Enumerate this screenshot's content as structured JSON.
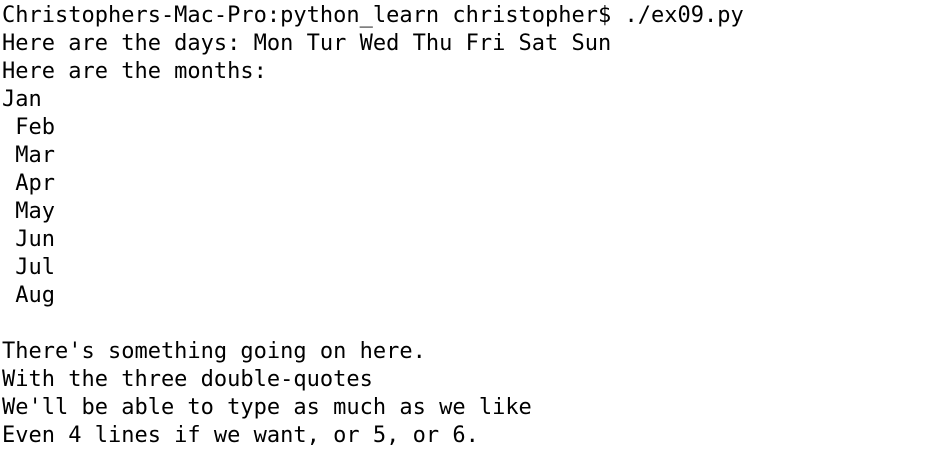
{
  "terminal": {
    "lines": [
      "Christophers-Mac-Pro:python_learn christopher$ ./ex09.py",
      "Here are the days: Mon Tur Wed Thu Fri Sat Sun",
      "Here are the months:",
      "Jan",
      " Feb",
      " Mar",
      " Apr",
      " May",
      " Jun",
      " Jul",
      " Aug",
      "",
      "There's something going on here.",
      "With the three double-quotes",
      "We'll be able to type as much as we like",
      "Even 4 lines if we want, or 5, or 6."
    ]
  },
  "colors": {
    "background": "#ffffff",
    "text": "#000000"
  }
}
